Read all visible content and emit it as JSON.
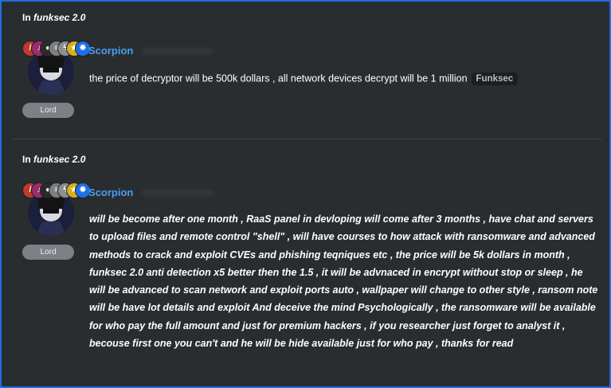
{
  "posts": [
    {
      "thread_prefix": "In ",
      "thread_name": "funksec 2.0",
      "username": "Scorpion",
      "rank": "Lord",
      "message": "the price of decryptor will be 500k dollars , all network devices decrypt will be 1 million",
      "tag": "Funksec",
      "badges": [
        {
          "icon": "slash-icon",
          "glyph": "/",
          "color": "#c0392b"
        },
        {
          "icon": "music-note-icon",
          "glyph": "♪",
          "color": "#9b2c6f"
        },
        {
          "icon": "record-icon",
          "glyph": "●",
          "color": "#2b2b2b"
        },
        {
          "icon": "document-icon",
          "glyph": "≡",
          "color": "#7d7d7d"
        },
        {
          "icon": "lightning-icon",
          "glyph": "ϟ",
          "color": "#8e8e8e"
        },
        {
          "icon": "star-icon",
          "glyph": "★",
          "color": "#d4b020"
        },
        {
          "icon": "gear-icon",
          "glyph": "✹",
          "color": "#1e6fe8"
        }
      ]
    },
    {
      "thread_prefix": "In ",
      "thread_name": "funksec 2.0",
      "username": "Scorpion",
      "rank": "Lord",
      "message": "will be become after one month , RaaS panel in devloping will come after 3 months , have chat and servers to upload files and remote control \"shell\" , will have courses to how attack with ransomware and advanced methods to crack and exploit CVEs and phishing teqniques etc , the price will be 5k dollars in month , funksec 2.0 anti detection x5 better then the 1.5 , it will be advnaced in encrypt without stop or sleep , he will be advanced to scan network and exploit ports auto , wallpaper will change to other style , ransom note will be have lot details and exploit And deceive the mind Psychologically , the ransomware will be available for who pay the full amount and just for premium hackers , if you researcher just forget to analyst it , becouse first one you can't and he will be hide available just for who pay , thanks for read"
    }
  ],
  "colors": {
    "accent": "#4a9ef0",
    "background": "#2a2d30",
    "frame": "#1f6fe0",
    "rank_pill": "#7b8187"
  }
}
